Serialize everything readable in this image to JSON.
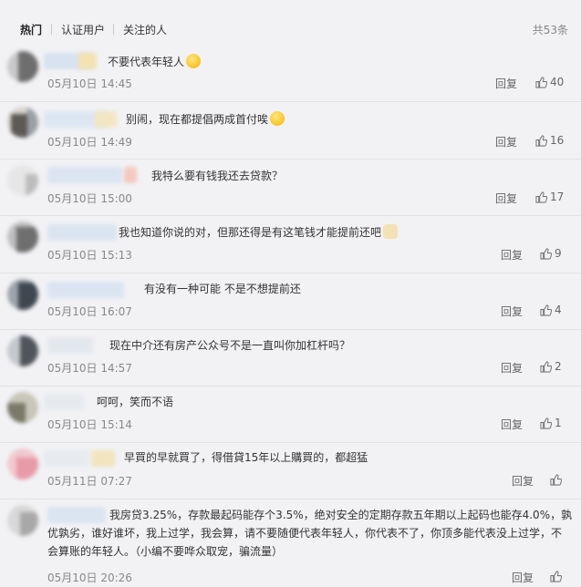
{
  "tabs": [
    {
      "label": "热门",
      "active": true
    },
    {
      "label": "认证用户",
      "active": false
    },
    {
      "label": "关注的人",
      "active": false
    }
  ],
  "total": "共53条",
  "reply_label": "回复",
  "emoji_names": [
    "scared-face-emoji",
    "smile-face-emoji",
    "cat-face-emoji"
  ],
  "comments": [
    {
      "text": "不要代表年轻人",
      "emoji": "scared-face-emoji",
      "time": "05月10日 14:45",
      "likes": "40"
    },
    {
      "text": "别闹，现在都提倡两成首付唉",
      "emoji": "smile-face-emoji",
      "time": "05月10日 14:49",
      "likes": "16"
    },
    {
      "text": "我特么要有钱我还去贷款？",
      "time": "05月10日 15:00",
      "likes": "17"
    },
    {
      "text": "我也知道你说的对，但那还得是有这笔钱才能提前还吧",
      "emoji": "cat-face-emoji",
      "time": "05月10日 15:13",
      "likes": "9"
    },
    {
      "text": "有没有一种可能 不是不想提前还",
      "time": "05月10日 16:07",
      "likes": "4"
    },
    {
      "text": "现在中介还有房产公众号不是一直叫你加杠杆吗？",
      "time": "05月10日 14:57",
      "likes": "2"
    },
    {
      "text": "呵呵，笑而不语",
      "time": "05月10日 15:14",
      "likes": "1"
    },
    {
      "text": "早買的早就買了，得借貸15年以上購買的，都超猛",
      "time": "05月11日 07:27",
      "likes": ""
    },
    {
      "text_lines": [
        "我房贷3.25%，存款最起码能存个3.5%，绝对安全的定期存款五年期以上起码也能存4.0%，孰",
        "优孰劣，谁好谁坏，我上过学，我会算，请不要随便代表年轻人，你代表不了，你顶多能代表没上过学，不",
        "会算账的年轻人。（小编不要哗众取宠，骗流量）"
      ],
      "time": "05月10日 20:26",
      "likes": ""
    }
  ]
}
